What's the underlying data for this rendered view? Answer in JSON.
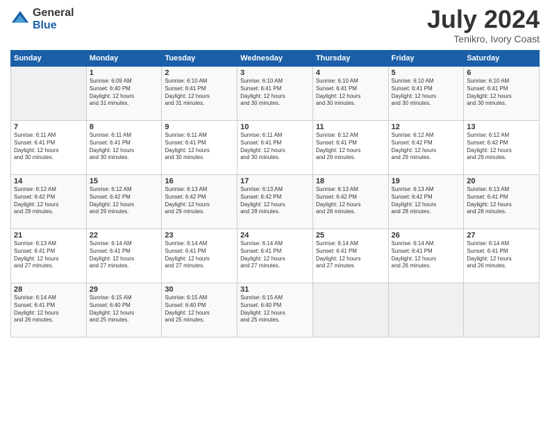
{
  "logo": {
    "general": "General",
    "blue": "Blue"
  },
  "header": {
    "month_year": "July 2024",
    "location": "Tenikro, Ivory Coast"
  },
  "days_of_week": [
    "Sunday",
    "Monday",
    "Tuesday",
    "Wednesday",
    "Thursday",
    "Friday",
    "Saturday"
  ],
  "weeks": [
    [
      {
        "day": "",
        "info": ""
      },
      {
        "day": "1",
        "info": "Sunrise: 6:09 AM\nSunset: 6:40 PM\nDaylight: 12 hours\nand 31 minutes."
      },
      {
        "day": "2",
        "info": "Sunrise: 6:10 AM\nSunset: 6:41 PM\nDaylight: 12 hours\nand 31 minutes."
      },
      {
        "day": "3",
        "info": "Sunrise: 6:10 AM\nSunset: 6:41 PM\nDaylight: 12 hours\nand 30 minutes."
      },
      {
        "day": "4",
        "info": "Sunrise: 6:10 AM\nSunset: 6:41 PM\nDaylight: 12 hours\nand 30 minutes."
      },
      {
        "day": "5",
        "info": "Sunrise: 6:10 AM\nSunset: 6:41 PM\nDaylight: 12 hours\nand 30 minutes."
      },
      {
        "day": "6",
        "info": "Sunrise: 6:10 AM\nSunset: 6:41 PM\nDaylight: 12 hours\nand 30 minutes."
      }
    ],
    [
      {
        "day": "7",
        "info": "Sunrise: 6:11 AM\nSunset: 6:41 PM\nDaylight: 12 hours\nand 30 minutes."
      },
      {
        "day": "8",
        "info": "Sunrise: 6:11 AM\nSunset: 6:41 PM\nDaylight: 12 hours\nand 30 minutes."
      },
      {
        "day": "9",
        "info": "Sunrise: 6:11 AM\nSunset: 6:41 PM\nDaylight: 12 hours\nand 30 minutes."
      },
      {
        "day": "10",
        "info": "Sunrise: 6:11 AM\nSunset: 6:41 PM\nDaylight: 12 hours\nand 30 minutes."
      },
      {
        "day": "11",
        "info": "Sunrise: 6:12 AM\nSunset: 6:41 PM\nDaylight: 12 hours\nand 29 minutes."
      },
      {
        "day": "12",
        "info": "Sunrise: 6:12 AM\nSunset: 6:42 PM\nDaylight: 12 hours\nand 29 minutes."
      },
      {
        "day": "13",
        "info": "Sunrise: 6:12 AM\nSunset: 6:42 PM\nDaylight: 12 hours\nand 29 minutes."
      }
    ],
    [
      {
        "day": "14",
        "info": "Sunrise: 6:12 AM\nSunset: 6:42 PM\nDaylight: 12 hours\nand 29 minutes."
      },
      {
        "day": "15",
        "info": "Sunrise: 6:12 AM\nSunset: 6:42 PM\nDaylight: 12 hours\nand 29 minutes."
      },
      {
        "day": "16",
        "info": "Sunrise: 6:13 AM\nSunset: 6:42 PM\nDaylight: 12 hours\nand 29 minutes."
      },
      {
        "day": "17",
        "info": "Sunrise: 6:13 AM\nSunset: 6:42 PM\nDaylight: 12 hours\nand 28 minutes."
      },
      {
        "day": "18",
        "info": "Sunrise: 6:13 AM\nSunset: 6:42 PM\nDaylight: 12 hours\nand 28 minutes."
      },
      {
        "day": "19",
        "info": "Sunrise: 6:13 AM\nSunset: 6:42 PM\nDaylight: 12 hours\nand 28 minutes."
      },
      {
        "day": "20",
        "info": "Sunrise: 6:13 AM\nSunset: 6:41 PM\nDaylight: 12 hours\nand 28 minutes."
      }
    ],
    [
      {
        "day": "21",
        "info": "Sunrise: 6:13 AM\nSunset: 6:41 PM\nDaylight: 12 hours\nand 27 minutes."
      },
      {
        "day": "22",
        "info": "Sunrise: 6:14 AM\nSunset: 6:41 PM\nDaylight: 12 hours\nand 27 minutes."
      },
      {
        "day": "23",
        "info": "Sunrise: 6:14 AM\nSunset: 6:41 PM\nDaylight: 12 hours\nand 27 minutes."
      },
      {
        "day": "24",
        "info": "Sunrise: 6:14 AM\nSunset: 6:41 PM\nDaylight: 12 hours\nand 27 minutes."
      },
      {
        "day": "25",
        "info": "Sunrise: 6:14 AM\nSunset: 6:41 PM\nDaylight: 12 hours\nand 27 minutes."
      },
      {
        "day": "26",
        "info": "Sunrise: 6:14 AM\nSunset: 6:41 PM\nDaylight: 12 hours\nand 26 minutes."
      },
      {
        "day": "27",
        "info": "Sunrise: 6:14 AM\nSunset: 6:41 PM\nDaylight: 12 hours\nand 26 minutes."
      }
    ],
    [
      {
        "day": "28",
        "info": "Sunrise: 6:14 AM\nSunset: 6:41 PM\nDaylight: 12 hours\nand 26 minutes."
      },
      {
        "day": "29",
        "info": "Sunrise: 6:15 AM\nSunset: 6:40 PM\nDaylight: 12 hours\nand 25 minutes."
      },
      {
        "day": "30",
        "info": "Sunrise: 6:15 AM\nSunset: 6:40 PM\nDaylight: 12 hours\nand 25 minutes."
      },
      {
        "day": "31",
        "info": "Sunrise: 6:15 AM\nSunset: 6:40 PM\nDaylight: 12 hours\nand 25 minutes."
      },
      {
        "day": "",
        "info": ""
      },
      {
        "day": "",
        "info": ""
      },
      {
        "day": "",
        "info": ""
      }
    ]
  ]
}
